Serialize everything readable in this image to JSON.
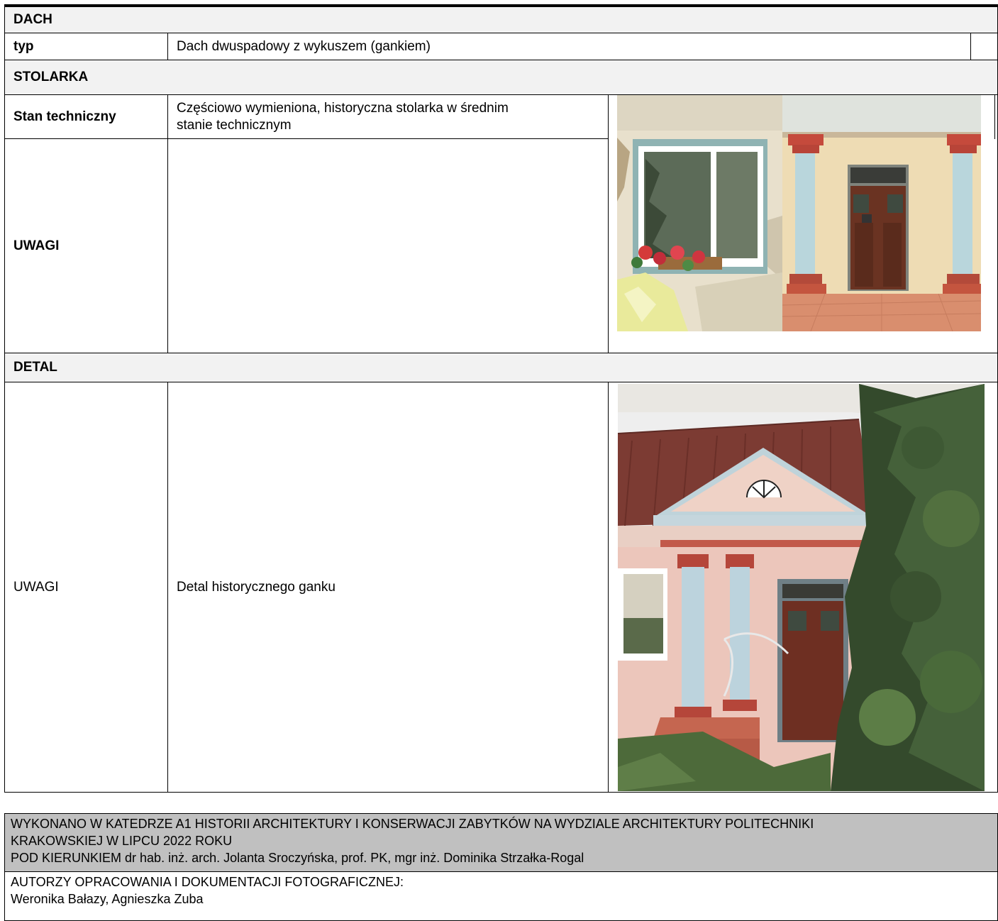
{
  "sections": {
    "dach": {
      "heading": "DACH",
      "label": "typ",
      "value": "Dach dwuspadowy z wykuszem (gankiem)"
    },
    "stolarka": {
      "heading": "STOLARKA",
      "stan_label": "Stan techniczny",
      "stan_value_line1": "Częściowo wymieniona, historyczna stolarka w średnim",
      "stan_value_line2": "stanie technicznym",
      "uwagi_label": "UWAGI",
      "uwagi_value": ""
    },
    "detal": {
      "heading": "DETAL",
      "uwagi_label": "UWAGI",
      "uwagi_value": "Detal historycznego ganku"
    }
  },
  "footer": {
    "line1": "WYKONANO W KATEDRZE A1 HISTORII ARCHITEKTURY I KONSERWACJI ZABYTKÓW NA WYDZIALE ARCHITEKTURY POLITECHNIKI",
    "line2": "KRAKOWSKIEJ W LIPCU 2022 ROKU",
    "line3": "POD KIERUNKIEM dr hab. inż. arch. Jolanta Sroczyńska, prof. PK,  mgr inż. Dominika Strzałka-Rogal",
    "authors_label": "AUTORZY OPRACOWANIA I DOKUMENTACJI FOTOGRAFICZNEJ:",
    "authors": "Weronika Bałazy, Agnieszka Zuba"
  },
  "colors": {
    "header_bg": "#f2f2f2",
    "footer_bg": "#c0c0c0",
    "border": "#000000"
  }
}
